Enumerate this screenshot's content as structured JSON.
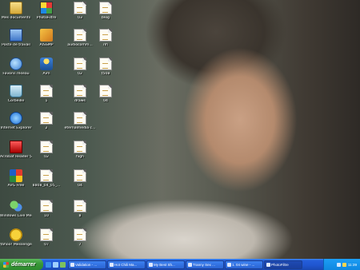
{
  "desktop": {
    "icons": [
      {
        "label": "Mes documents",
        "icon": "my-documents-icon",
        "type": "docs"
      },
      {
        "label": "Poste de travail",
        "icon": "my-computer-icon",
        "type": "pc"
      },
      {
        "label": "Favoris réseau",
        "icon": "network-icon",
        "type": "net"
      },
      {
        "label": "Corbeille",
        "icon": "recycle-bin-icon",
        "type": "bin"
      },
      {
        "label": "Internet Explorer",
        "icon": "internet-explorer-icon",
        "type": "ie"
      },
      {
        "label": "Acrobat Reader 5.0",
        "icon": "acrobat-reader-icon",
        "type": "adobe"
      },
      {
        "label": "AVG Free",
        "icon": "avg-icon",
        "type": "avg"
      },
      {
        "label": "Windows Live Messenger",
        "icon": "msn-messenger-icon",
        "type": "msn"
      },
      {
        "label": "Yahoo! Messenger",
        "icon": "yahoo-messenger-icon",
        "type": "yahoo"
      },
      {
        "label": "PhotoFiltre",
        "icon": "photofiltre-icon",
        "type": "photo"
      },
      {
        "label": "AISSMP",
        "icon": "aissmp-icon",
        "type": "ais"
      },
      {
        "label": "Aim",
        "icon": "aim-icon",
        "type": "aim"
      },
      {
        "label": "1",
        "icon": "file-icon",
        "type": "file"
      },
      {
        "label": "2",
        "icon": "file-icon",
        "type": "file"
      },
      {
        "label": "02",
        "icon": "file-icon",
        "type": "file"
      },
      {
        "label": "8808_04_05_...",
        "icon": "file-icon",
        "type": "file"
      },
      {
        "label": "10",
        "icon": "file-icon",
        "type": "file"
      },
      {
        "label": "07",
        "icon": "file-icon",
        "type": "file"
      },
      {
        "label": "03",
        "icon": "file-icon",
        "type": "file"
      },
      {
        "label": "audiocomm...",
        "icon": "file-icon",
        "type": "file"
      },
      {
        "label": "02",
        "icon": "file-icon",
        "type": "file"
      },
      {
        "label": "draws",
        "icon": "file-icon",
        "type": "file"
      },
      {
        "label": "eternalmedia c...",
        "icon": "file-icon",
        "type": "file"
      },
      {
        "label": "high",
        "icon": "file-icon",
        "type": "file"
      },
      {
        "label": "04",
        "icon": "file-icon",
        "type": "file"
      },
      {
        "label": "8",
        "icon": "file-icon",
        "type": "file"
      },
      {
        "label": "7",
        "icon": "file-icon",
        "type": "file"
      },
      {
        "label": "blog",
        "icon": "file-icon",
        "type": "file"
      },
      {
        "label": "nfl",
        "icon": "file-icon",
        "type": "file"
      },
      {
        "label": "t508",
        "icon": "file-icon",
        "type": "file"
      },
      {
        "label": "04",
        "icon": "file-icon",
        "type": "file"
      }
    ]
  },
  "taskbar": {
    "start_label": "démarrer",
    "quick_launch": [
      "ie-quicklaunch-icon",
      "desktop-quicklaunch-icon",
      "messenger-quicklaunch-icon"
    ],
    "tasks": [
      {
        "label": "Validation - ..."
      },
      {
        "label": "Hot Chili Ma..."
      },
      {
        "label": "My Best Sh..."
      },
      {
        "label": "Tranny Sex ..."
      },
      {
        "label": "1. 04 wine - ..."
      },
      {
        "label": "PhotoFiltre"
      }
    ],
    "clock": "11:39"
  },
  "colors": {
    "taskbar_blue": "#245edb",
    "start_green": "#3a9a3a",
    "tray_blue": "#0f87e0"
  }
}
